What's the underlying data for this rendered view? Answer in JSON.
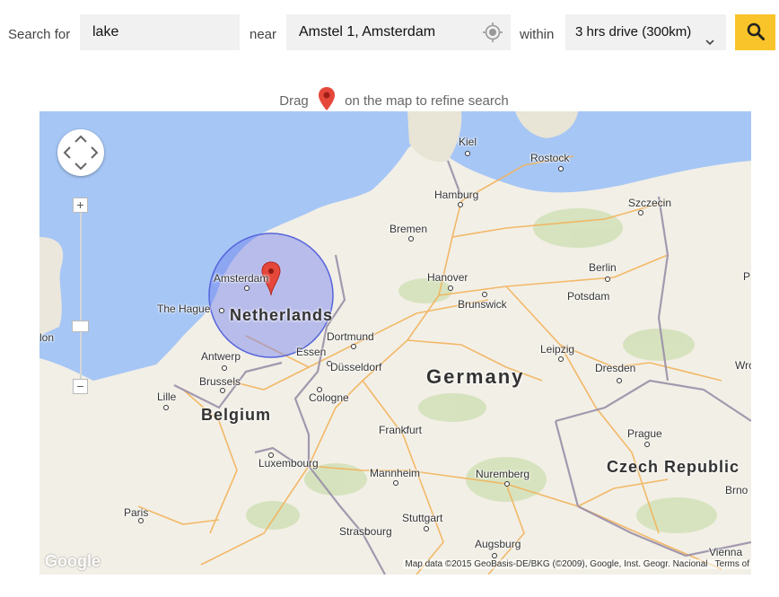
{
  "search": {
    "label_for": "Search for",
    "query": "lake",
    "label_near": "near",
    "location": "Amstel 1, Amsterdam",
    "label_within": "within",
    "range": "3 hrs drive (300km)"
  },
  "hint": {
    "before": "Drag",
    "after": "on the map to refine search"
  },
  "map": {
    "cities": [
      "Kiel",
      "Rostock",
      "Hamburg",
      "Szczecin",
      "Bremen",
      "Amsterdam",
      "Hanover",
      "Berlin",
      "The Hague",
      "Brunswick",
      "Potsdam",
      "Dortmund",
      "Leipzig",
      "Antwerp",
      "Essen",
      "Düsseldorf",
      "Dresden",
      "Brussels",
      "Lille",
      "Cologne",
      "Frankfurt",
      "Prague",
      "Luxembourg",
      "Mannheim",
      "Nuremberg",
      "Paris",
      "Stuttgart",
      "Strasbourg",
      "Augsburg",
      "Brno",
      "Wro",
      "lon",
      "Vienna",
      "P"
    ],
    "countries": [
      "Netherlands",
      "Germany",
      "Belgium",
      "Czech Republic"
    ],
    "google": "Google",
    "attribution": "Map data ©2015 GeoBasis-DE/BKG (©2009), Google, Inst. Geogr. Nacional",
    "terms": "Terms of"
  },
  "colors": {
    "accent": "#f9c429",
    "water": "#a6c6f5",
    "radius": "#6f7ff0",
    "pin": "#e5483b"
  },
  "icons": [
    "gps-target-icon",
    "chevron-down-icon",
    "search-icon",
    "map-pin-icon"
  ]
}
